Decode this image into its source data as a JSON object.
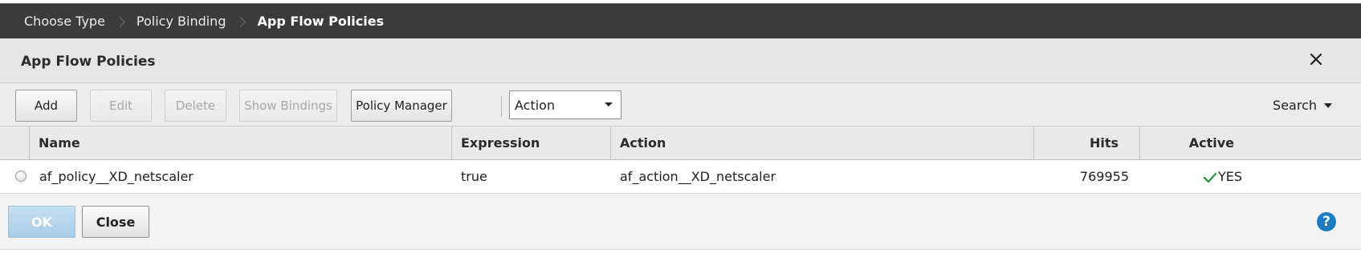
{
  "breadcrumb": {
    "items": [
      {
        "label": "Choose Type"
      },
      {
        "label": "Policy Binding"
      },
      {
        "label": "App Flow Policies"
      }
    ]
  },
  "dialog": {
    "title": "App Flow Policies"
  },
  "toolbar": {
    "add_label": "Add",
    "edit_label": "Edit",
    "delete_label": "Delete",
    "show_bindings_label": "Show Bindings",
    "policy_manager_label": "Policy Manager",
    "action_select_value": "Action",
    "search_label": "Search"
  },
  "table": {
    "columns": {
      "name": "Name",
      "expression": "Expression",
      "action": "Action",
      "hits": "Hits",
      "active": "Active"
    },
    "rows": [
      {
        "name": "af_policy__XD_netscaler",
        "expression": "true",
        "action": "af_action__XD_netscaler",
        "hits": "769955",
        "active": "YES"
      }
    ]
  },
  "footer": {
    "ok_label": "OK",
    "close_label": "Close",
    "help_symbol": "?"
  },
  "colors": {
    "breadcrumb_bg": "#3a3b3d",
    "ok_button": "#b7d5ec",
    "help_icon": "#1a7dc4",
    "active_check": "#2e9a3c"
  }
}
